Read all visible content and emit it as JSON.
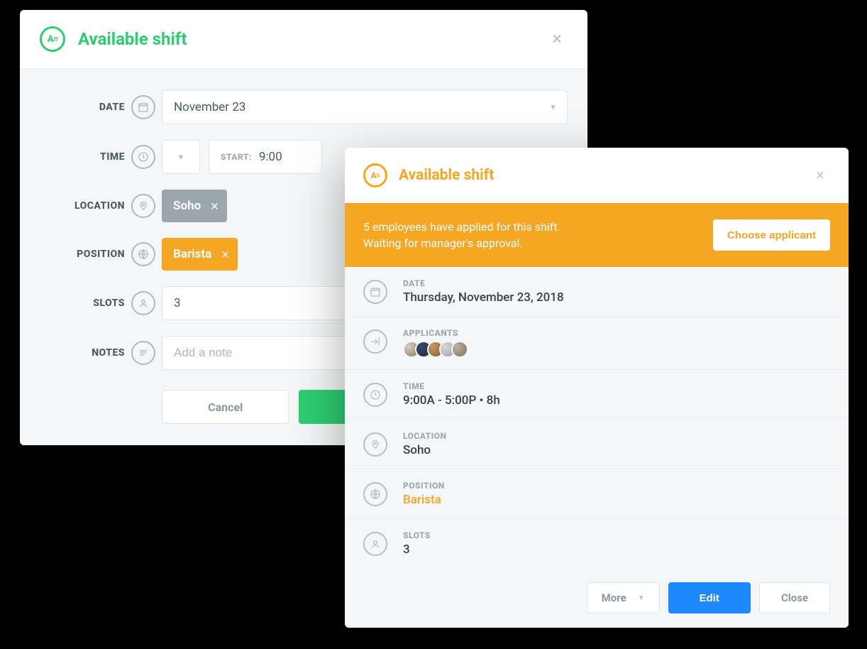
{
  "form": {
    "title": "Available shift",
    "labels": {
      "date": "DATE",
      "time": "TIME",
      "location": "LOCATION",
      "position": "POSITION",
      "slots": "SLOTS",
      "notes": "NOTES"
    },
    "date_value": "November 23",
    "time_start_label": "START:",
    "time_start_value": "9:00",
    "location_chip": "Soho",
    "position_chip": "Barista",
    "slots_value": "3",
    "notes_placeholder": "Add a note",
    "cancel": "Cancel"
  },
  "detail": {
    "title": "Available shift",
    "banner_line1": "5 employees have applied for this shift.",
    "banner_line2": "Waiting for manager's approval.",
    "choose_applicant": "Choose applicant",
    "labels": {
      "date": "DATE",
      "applicants": "APPLICANTS",
      "time": "TIME",
      "location": "LOCATION",
      "position": "POSITION",
      "slots": "SLOTS"
    },
    "date_value": "Thursday, November 23, 2018",
    "time_value": "9:00A - 5:00P • 8h",
    "location_value": "Soho",
    "position_value": "Barista",
    "slots_value": "3",
    "footer": {
      "more": "More",
      "edit": "Edit",
      "close": "Close"
    }
  }
}
